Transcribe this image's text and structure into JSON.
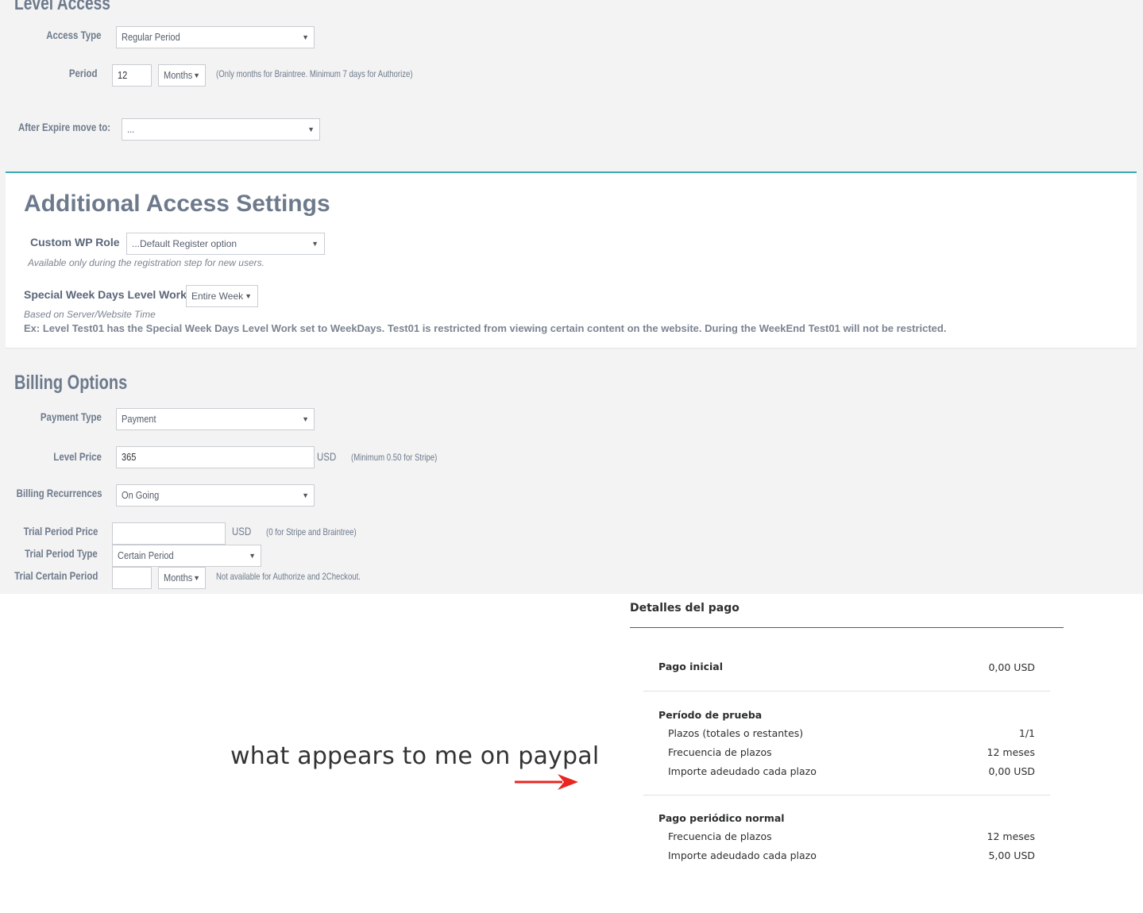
{
  "level_access": {
    "section_title": "Level Access",
    "access_type_label": "Access Type",
    "access_type_value": "Regular Period",
    "period_label": "Period",
    "period_value": "12",
    "period_unit": "Months",
    "period_hint": "(Only months for Braintree. Minimum 7 days for Authorize)",
    "after_expire_label": "After Expire move to:",
    "after_expire_value": "..."
  },
  "additional": {
    "title": "Additional Access Settings",
    "custom_role_label": "Custom WP Role",
    "custom_role_value": "...Default Register option",
    "custom_role_note": "Available only during the registration step for new users.",
    "week_days_label": "Special Week Days Level Work",
    "week_days_value": "Entire Week",
    "server_time_note": "Based on Server/Website Time",
    "example_note": "Ex: Level Test01 has the Special Week Days Level Work set to WeekDays. Test01 is restricted from viewing certain content on the website. During the WeekEnd Test01 will not be restricted."
  },
  "billing": {
    "title": "Billing Options",
    "payment_type_label": "Payment Type",
    "payment_type_value": "Payment",
    "level_price_label": "Level Price",
    "level_price_value": "365",
    "level_price_currency": "USD",
    "level_price_hint": "(Minimum 0.50 for Stripe)",
    "recurrences_label": "Billing Recurrences",
    "recurrences_value": "On Going",
    "trial_price_label": "Trial Period Price",
    "trial_price_value": "",
    "trial_price_currency": "USD",
    "trial_price_hint": "(0 for Stripe and Braintree)",
    "trial_type_label": "Trial Period Type",
    "trial_type_value": "Certain Period",
    "trial_certain_label": "Trial Certain Period",
    "trial_certain_value": "",
    "trial_certain_unit": "Months",
    "trial_certain_hint": "Not available for Authorize and 2Checkout."
  },
  "caption": "what appears to me on paypal",
  "paypal": {
    "title": "Detalles del pago",
    "initial_label": "Pago inicial",
    "initial_value": "0,00 USD",
    "trial_heading": "Período de prueba",
    "trial_installments_label": "Plazos (totales o restantes)",
    "trial_installments_value": "1/1",
    "trial_frequency_label": "Frecuencia de plazos",
    "trial_frequency_value": "12 meses",
    "trial_amount_label": "Importe adeudado cada plazo",
    "trial_amount_value": "0,00 USD",
    "regular_heading": "Pago periódico normal",
    "regular_frequency_label": "Frecuencia de plazos",
    "regular_frequency_value": "12 meses",
    "regular_amount_label": "Importe adeudado cada plazo",
    "regular_amount_value": "5,00 USD"
  },
  "colors": {
    "accent_teal": "#3aa9b2",
    "arrow_red": "#e8261f",
    "label_slate": "#6d7a8c"
  }
}
